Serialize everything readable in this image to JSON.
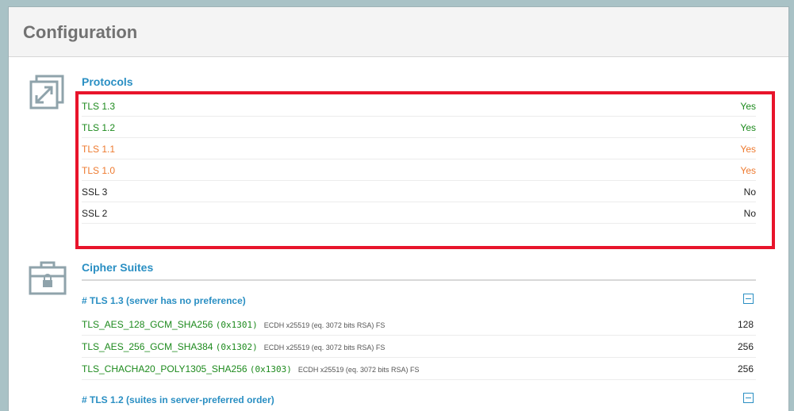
{
  "panel": {
    "title": "Configuration"
  },
  "protocols": {
    "title": "Protocols",
    "rows": [
      {
        "label": "TLS 1.3",
        "value": "Yes"
      },
      {
        "label": "TLS 1.2",
        "value": "Yes"
      },
      {
        "label": "TLS 1.1",
        "value": "Yes"
      },
      {
        "label": "TLS 1.0",
        "value": "Yes"
      },
      {
        "label": "SSL 3",
        "value": "No"
      },
      {
        "label": "SSL 2",
        "value": "No"
      }
    ]
  },
  "ciphers": {
    "title": "Cipher Suites",
    "groups": [
      {
        "title": "# TLS 1.3 (server has no preference)",
        "suites": [
          {
            "name": "TLS_AES_128_GCM_SHA256",
            "code": "(0x1301)",
            "info": "ECDH x25519 (eq. 3072 bits RSA)   FS",
            "bits": "128"
          },
          {
            "name": "TLS_AES_256_GCM_SHA384",
            "code": "(0x1302)",
            "info": "ECDH x25519 (eq. 3072 bits RSA)   FS",
            "bits": "256"
          },
          {
            "name": "TLS_CHACHA20_POLY1305_SHA256",
            "code": "(0x1303)",
            "info": "ECDH x25519 (eq. 3072 bits RSA)   FS",
            "bits": "256"
          }
        ]
      },
      {
        "title": "# TLS 1.2 (suites in server-preferred order)"
      }
    ]
  },
  "colors": {
    "green": "#1d8a1d",
    "orange": "#ee7a2f",
    "accent": "#2a8fc3",
    "highlight": "#e8142b"
  },
  "icons": {
    "protocols": "expand-arrows-icon",
    "ciphers": "locked-toolbox-icon",
    "toggle": "collapse-minus-icon"
  }
}
